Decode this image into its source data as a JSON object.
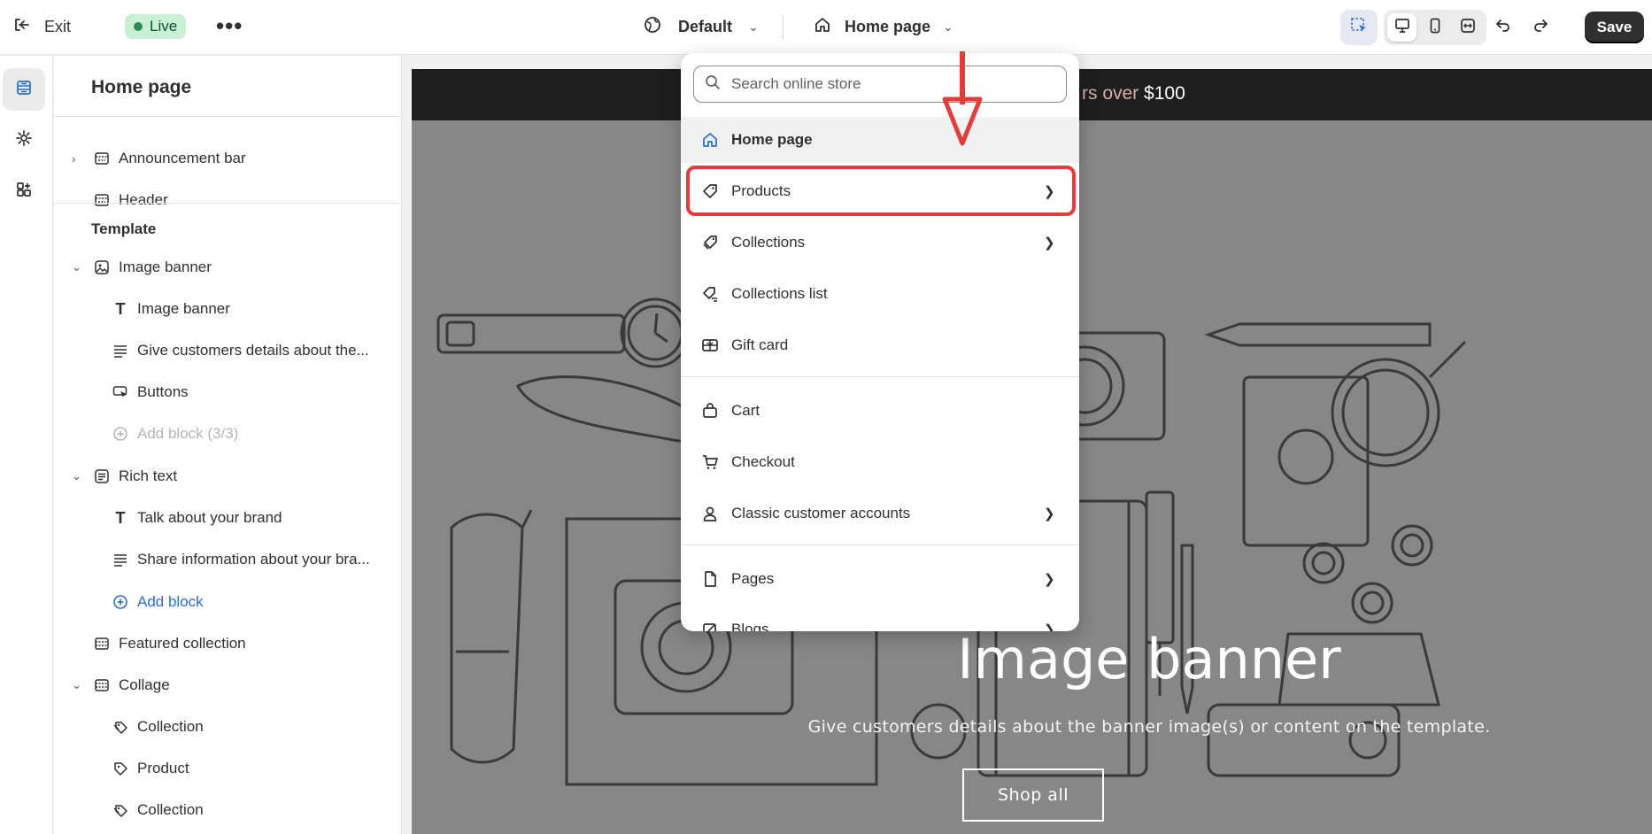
{
  "topbar": {
    "exit_label": "Exit",
    "status_label": "Live",
    "more_label": "•••",
    "theme_label": "Default",
    "page_label": "Home page",
    "save_label": "Save"
  },
  "sidebar": {
    "title": "Home page",
    "header_sections": [
      {
        "label": "Announcement bar"
      },
      {
        "label": "Header"
      }
    ],
    "template_label": "Template",
    "items": [
      {
        "label": "Image banner"
      },
      {
        "label": "Image banner"
      },
      {
        "label": "Give customers details about the..."
      },
      {
        "label": "Buttons"
      },
      {
        "label": "Add block (3/3)"
      },
      {
        "label": "Rich text"
      },
      {
        "label": "Talk about your brand"
      },
      {
        "label": "Share information about your bra..."
      },
      {
        "label": "Add block"
      },
      {
        "label": "Featured collection"
      },
      {
        "label": "Collage"
      },
      {
        "label": "Collection"
      },
      {
        "label": "Product"
      },
      {
        "label": "Collection"
      }
    ]
  },
  "dropdown": {
    "search_placeholder": "Search online store",
    "items": [
      {
        "label": "Home page",
        "icon": "home-icon"
      },
      {
        "label": "Products",
        "icon": "tag-icon"
      },
      {
        "label": "Collections",
        "icon": "tags-icon"
      },
      {
        "label": "Collections list",
        "icon": "tags-list-icon"
      },
      {
        "label": "Gift card",
        "icon": "gift-card-icon"
      },
      {
        "label": "Cart",
        "icon": "bag-icon"
      },
      {
        "label": "Checkout",
        "icon": "cart-icon"
      },
      {
        "label": "Classic customer accounts",
        "icon": "person-icon"
      },
      {
        "label": "Pages",
        "icon": "page-icon"
      },
      {
        "label": "Blogs",
        "icon": "blog-icon"
      }
    ]
  },
  "preview": {
    "announcement_dim": "rs over",
    "announcement_bright": "$100",
    "banner_title": "Image banner",
    "banner_subtitle": "Give customers details about the banner image(s) or content on the template.",
    "banner_button": "Shop all"
  },
  "colors": {
    "highlight": "#e43b3b",
    "live_badge": "#c9f0d4",
    "link": "#2c6ecb",
    "save_button": "#303030"
  }
}
